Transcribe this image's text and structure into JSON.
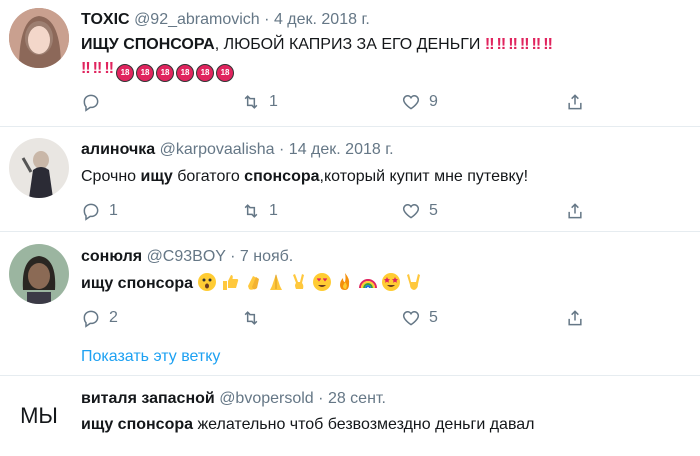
{
  "tweets": [
    {
      "name": "TOXIC",
      "handle": "@92_abramovich",
      "dot": "·",
      "date": "4 дек. 2018 г.",
      "text_bold": "ИЩУ СПОНСОРА",
      "text_rest": ", ЛЮБОЙ КАПРИЗ ЗА ЕГО ДЕНЬГИ",
      "badge_18": "18",
      "replies": "",
      "retweets": "1",
      "likes": "9"
    },
    {
      "name": "алиночка",
      "handle": "@karpovaalisha",
      "dot": "·",
      "date": "14 дек. 2018 г.",
      "text_p1": "Срочно ",
      "text_b1": "ищу",
      "text_p2": " богатого ",
      "text_b2": "спонсора",
      "text_p3": ",который купит мне путевку!",
      "replies": "1",
      "retweets": "1",
      "likes": "5"
    },
    {
      "name": "сонюля",
      "handle": "@C93BOY",
      "dot": "·",
      "date": "7 нояб.",
      "text_bold": "ищу спонсора",
      "replies": "2",
      "retweets": "",
      "likes": "5",
      "show_thread": "Показать эту ветку"
    },
    {
      "name": "виталя запасной",
      "handle": "@bvopersold",
      "dot": "·",
      "date": "28 сент.",
      "avatar_text": "МЫ",
      "text_bold": "ищу спонсора",
      "text_rest": " желательно чтоб безвозмездно деньги давал"
    }
  ],
  "colors": {
    "link": "#1da1f2",
    "muted": "#657786",
    "badge": "#e0245e",
    "divider": "#e6ecf0"
  }
}
